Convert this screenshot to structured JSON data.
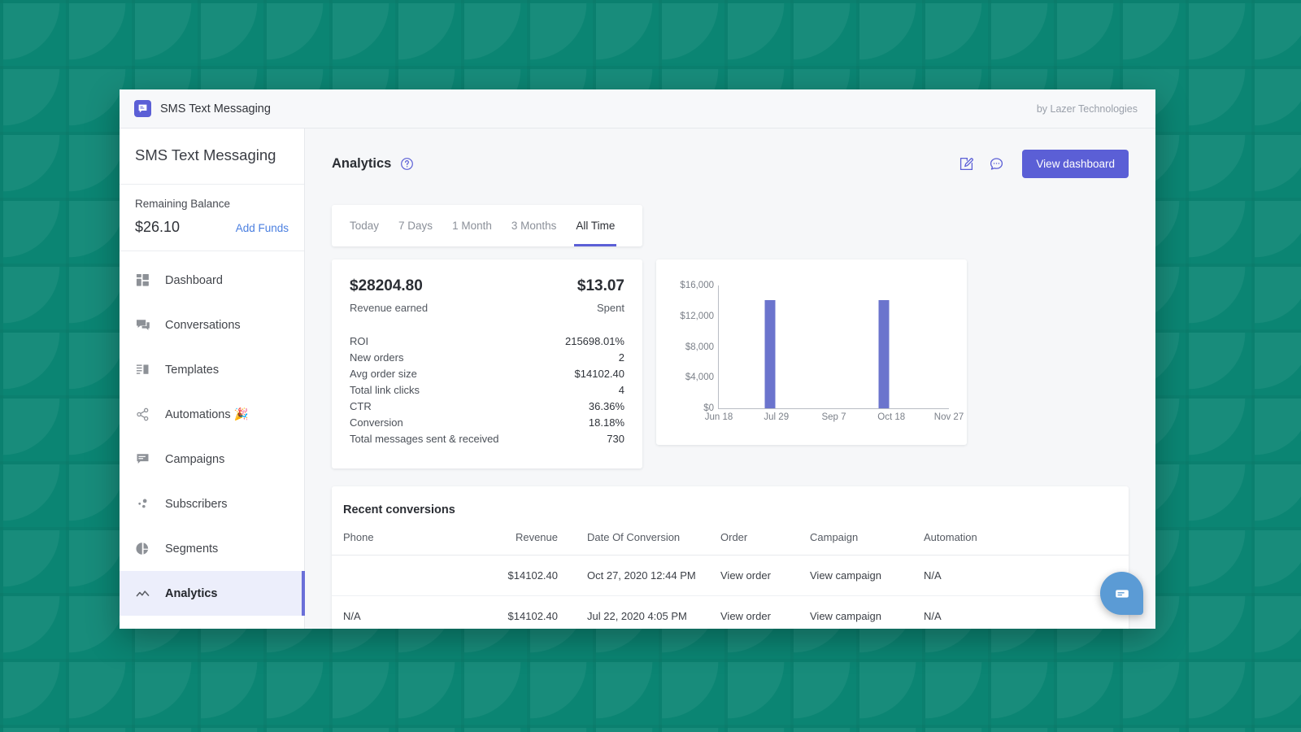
{
  "topbar": {
    "app_title": "SMS Text Messaging",
    "byline": "by Lazer Technologies",
    "logo_icon": "speech-bubble-logo-icon"
  },
  "sidebar": {
    "brand": "SMS Text Messaging",
    "balance_label": "Remaining Balance",
    "balance_amount": "$26.10",
    "add_funds_label": "Add Funds",
    "items": [
      {
        "label": "Dashboard",
        "icon": "dashboard-grid-icon",
        "active": false
      },
      {
        "label": "Conversations",
        "icon": "chat-bubbles-icon",
        "active": false
      },
      {
        "label": "Templates",
        "icon": "list-panel-icon",
        "active": false
      },
      {
        "label": "Automations 🎉",
        "icon": "share-nodes-icon",
        "active": false
      },
      {
        "label": "Campaigns",
        "icon": "message-square-icon",
        "active": false
      },
      {
        "label": "Subscribers",
        "icon": "scatter-dots-icon",
        "active": false
      },
      {
        "label": "Segments",
        "icon": "pie-chart-icon",
        "active": false
      },
      {
        "label": "Analytics",
        "icon": "line-chart-icon",
        "active": true
      }
    ]
  },
  "header": {
    "title": "Analytics",
    "help_icon": "question-circle-icon",
    "edit_icon": "edit-square-icon",
    "chat_icon": "chat-dots-icon",
    "view_dashboard_label": "View dashboard"
  },
  "tabs": [
    {
      "label": "Today",
      "active": false
    },
    {
      "label": "7 Days",
      "active": false
    },
    {
      "label": "1 Month",
      "active": false
    },
    {
      "label": "3 Months",
      "active": false
    },
    {
      "label": "All Time",
      "active": true
    }
  ],
  "stats": {
    "revenue_value": "$28204.80",
    "revenue_label": "Revenue earned",
    "spent_value": "$13.07",
    "spent_label": "Spent",
    "metrics": [
      {
        "label": "ROI",
        "value": "215698.01%"
      },
      {
        "label": "New orders",
        "value": "2"
      },
      {
        "label": "Avg order size",
        "value": "$14102.40"
      },
      {
        "label": "Total link clicks",
        "value": "4"
      },
      {
        "label": "CTR",
        "value": "36.36%"
      },
      {
        "label": "Conversion",
        "value": "18.18%"
      },
      {
        "label": "Total messages sent & received",
        "value": "730"
      }
    ]
  },
  "chart_data": {
    "type": "bar",
    "title": "",
    "xlabel": "",
    "ylabel": "",
    "grid": false,
    "legend": null,
    "bar_color": "#6b74cd",
    "ylim": [
      0,
      16000
    ],
    "y_ticks": [
      "$0",
      "$4,000",
      "$8,000",
      "$12,000",
      "$16,000"
    ],
    "y_tick_values": [
      0,
      4000,
      8000,
      12000,
      16000
    ],
    "x_ticks": [
      "Jun 18",
      "Jul 29",
      "Sep 7",
      "Oct 18",
      "Nov 27"
    ],
    "x_tick_positions": [
      0,
      0.25,
      0.5,
      0.75,
      1.0
    ],
    "categories": [
      "Jul 22",
      "Oct 27"
    ],
    "values": [
      14102.4,
      14102.4
    ],
    "bar_x_positions": [
      0.222,
      0.718
    ]
  },
  "conversions": {
    "title": "Recent conversions",
    "columns": [
      "Phone",
      "Revenue",
      "Date Of Conversion",
      "Order",
      "Campaign",
      "Automation"
    ],
    "rows": [
      {
        "phone": "",
        "revenue": "$14102.40",
        "date": "Oct 27, 2020 12:44 PM",
        "order": "View order",
        "campaign": "View campaign",
        "automation": "N/A"
      },
      {
        "phone": "N/A",
        "revenue": "$14102.40",
        "date": "Jul 22, 2020 4:05 PM",
        "order": "View order",
        "campaign": "View campaign",
        "automation": "N/A"
      }
    ]
  },
  "chat_launcher": {
    "icon": "chat-message-icon"
  },
  "colors": {
    "brand_purple": "#5b5fd6",
    "bar_indigo": "#6b74cd",
    "link_blue": "#4a7fe0",
    "background_teal": "#0b8573",
    "chat_blue": "#5b9bd5"
  }
}
